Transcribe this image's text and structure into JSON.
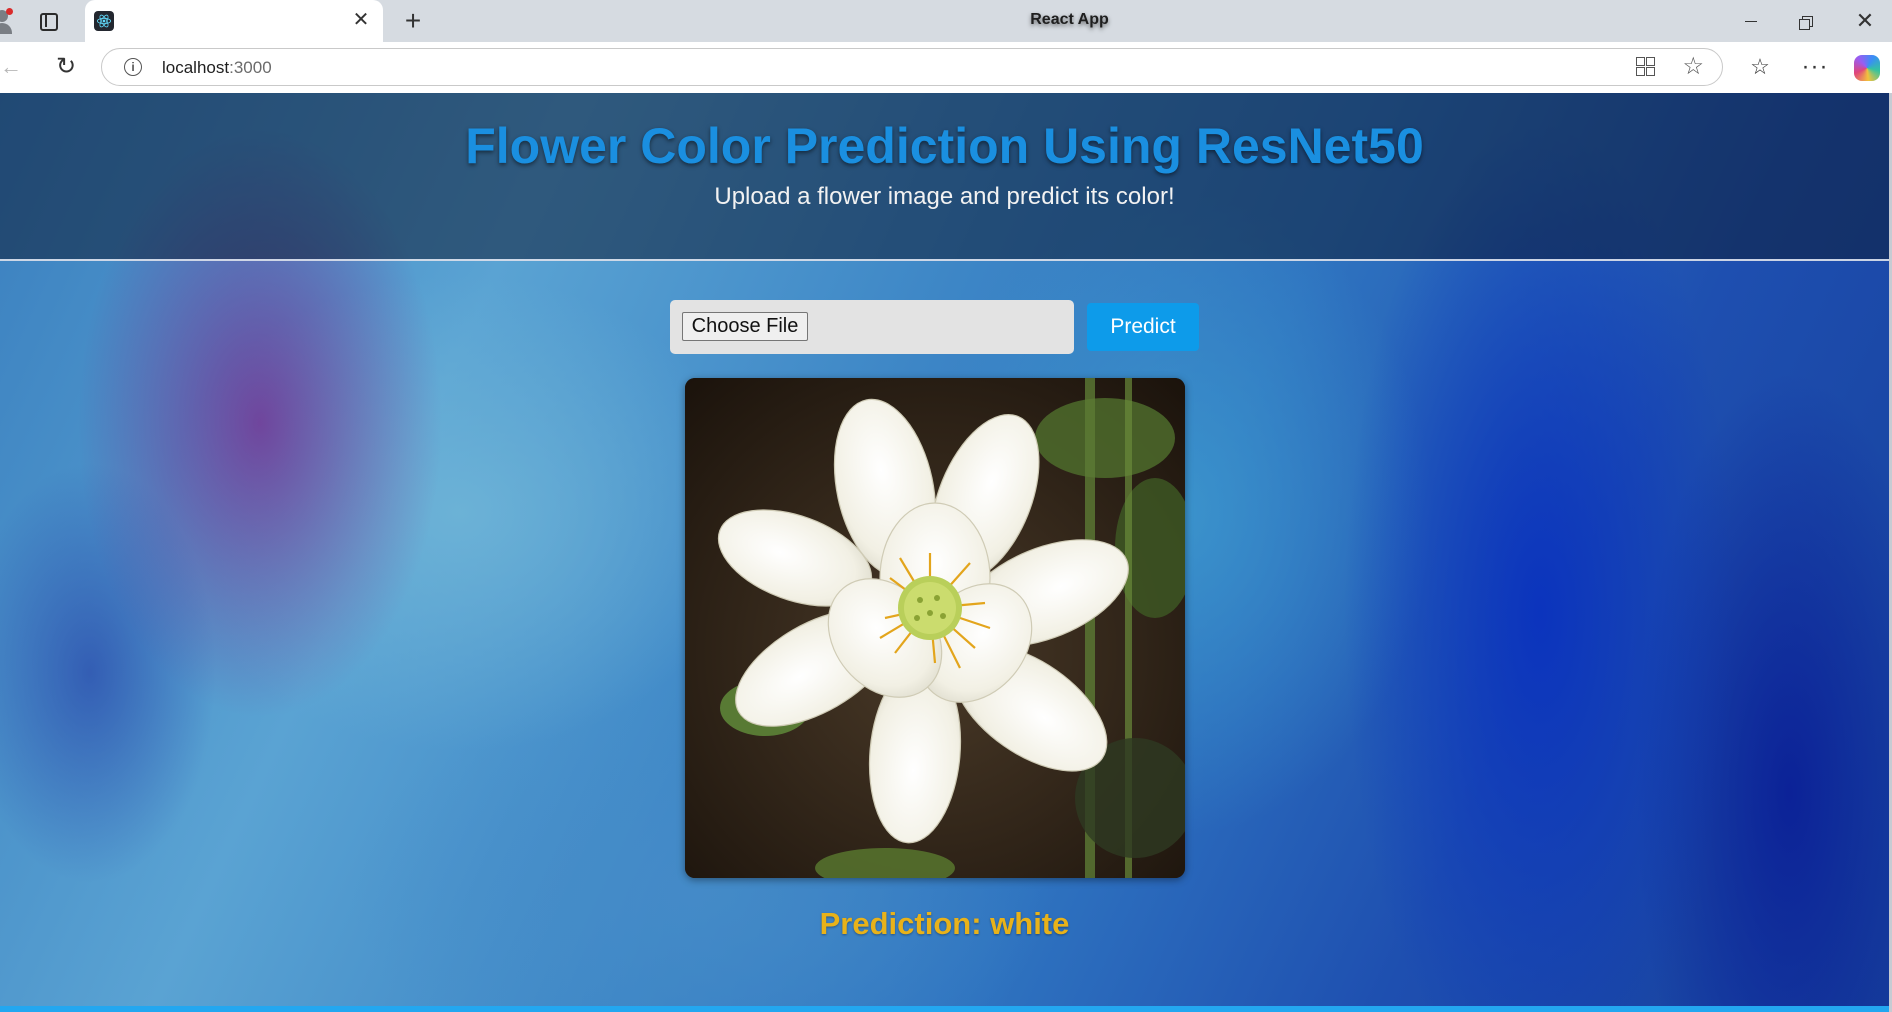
{
  "browser": {
    "tab_title": "React App",
    "url_host": "localhost",
    "url_port": ":3000"
  },
  "icons": {
    "profile": "profile-icon",
    "tab_actions": "tab-actions-icon",
    "react_favicon": "react-favicon-icon",
    "close": "close-icon",
    "new_tab": "plus-icon",
    "minimize": "minimize-icon",
    "restore": "restore-icon",
    "window_close": "window-close-icon",
    "back": "back-arrow-icon",
    "reload": "reload-icon",
    "info": "info-icon",
    "apps": "apps-icon",
    "favorite": "star-icon",
    "favorites": "favorites-icon",
    "more": "more-icon",
    "copilot": "copilot-icon"
  },
  "header": {
    "title": "Flower Color Prediction Using ResNet50",
    "subtitle": "Upload a flower image and predict its color!"
  },
  "upload": {
    "choose_file_label": "Choose File",
    "predict_label": "Predict"
  },
  "result": {
    "prediction_text": "Prediction: white"
  },
  "colors": {
    "title": "#1a8fe0",
    "predict_button": "#0d9bea",
    "prediction": "#e8b21a"
  }
}
